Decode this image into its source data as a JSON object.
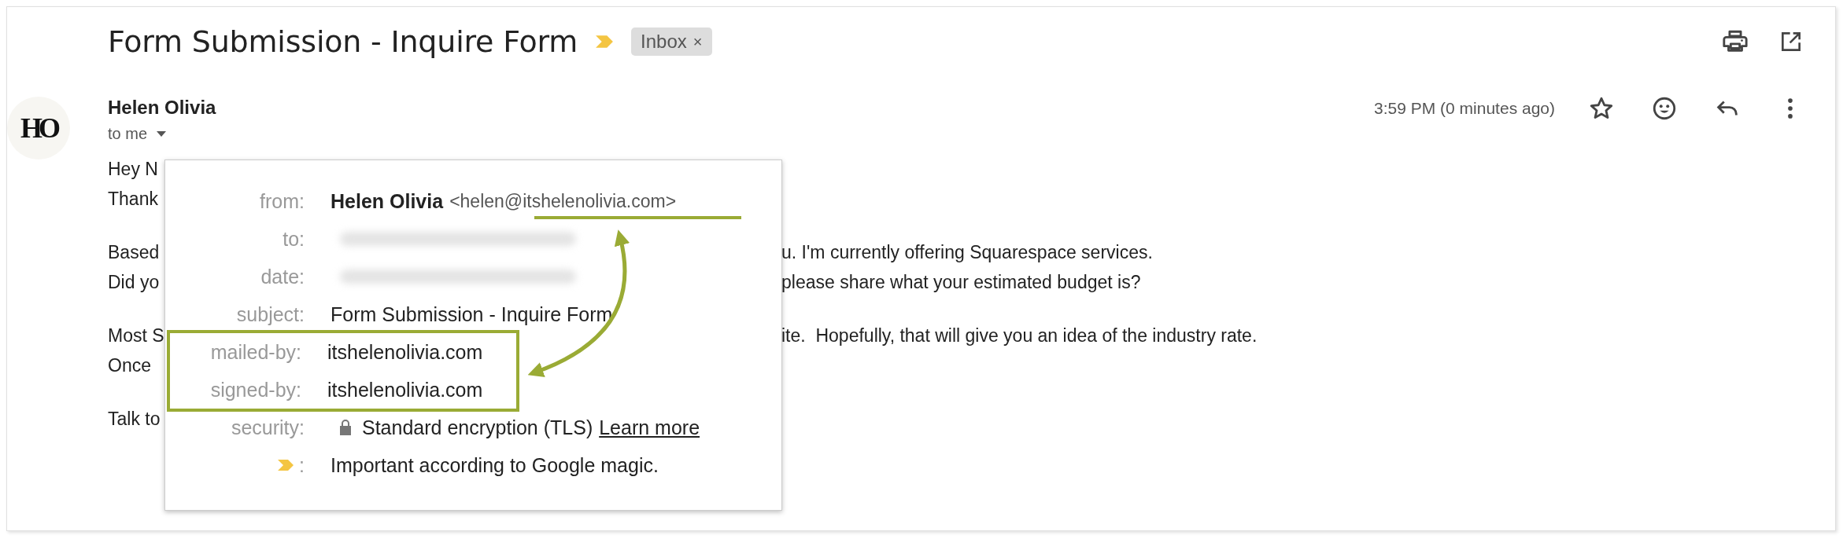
{
  "header": {
    "subject": "Form Submission - Inquire Form",
    "important": true,
    "label": {
      "text": "Inbox",
      "close": "×"
    }
  },
  "sender": {
    "avatar": "HO",
    "name": "Helen Olivia",
    "recipient": "to me",
    "time": "3:59 PM (0 minutes ago)",
    "starred": false
  },
  "body": {
    "paragraphs": [
      {
        "lines": [
          {
            "left": "Hey N"
          },
          {
            "left": "Thank"
          }
        ]
      },
      {
        "lines": [
          {
            "left": "Based",
            "right": "u. I'm currently offering Squarespace services."
          },
          {
            "left": "Did yo",
            "right": "please share what your estimated budget is?"
          }
        ]
      },
      {
        "lines": [
          {
            "left": "Most S",
            "right": "ite.  Hopefully, that will give you an idea of the industry rate."
          },
          {
            "left": "Once"
          }
        ]
      },
      {
        "lines": [
          {
            "left": "Talk to"
          }
        ]
      }
    ]
  },
  "details": {
    "rows": [
      {
        "kind": "from",
        "label": "from:",
        "name": "Helen Olivia",
        "email": "<helen@itshelenolivia.com>",
        "underlined": true
      },
      {
        "kind": "redacted",
        "label": "to:"
      },
      {
        "kind": "redacted",
        "label": "date:"
      },
      {
        "kind": "text",
        "label": "subject:",
        "value": "Form Submission - Inquire Form"
      },
      {
        "kind": "text",
        "label": "mailed-by:",
        "value": "itshelenolivia.com",
        "highlighted": true
      },
      {
        "kind": "text",
        "label": "signed-by:",
        "value": "itshelenolivia.com",
        "highlighted": true
      },
      {
        "kind": "security",
        "label": "security:",
        "value": "Standard encryption (TLS)",
        "link": "Learn more"
      },
      {
        "kind": "importance",
        "label": ":",
        "value": "Important according to Google magic."
      }
    ]
  }
}
